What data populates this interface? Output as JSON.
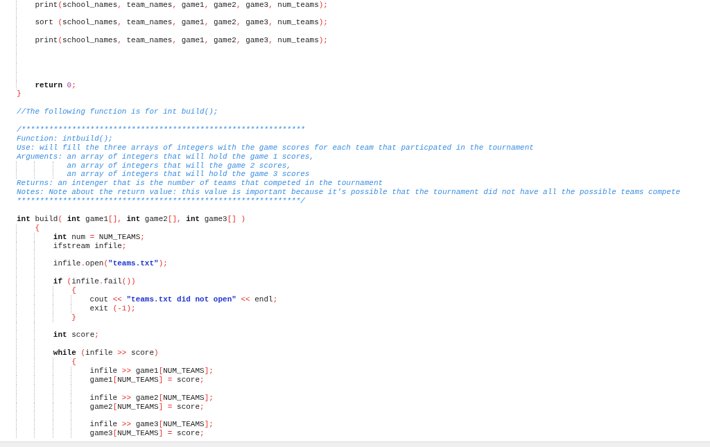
{
  "editor": {
    "lines": [
      {
        "kind": "code",
        "tokens": [
          {
            "kind": "plain",
            "text": "    print"
          },
          {
            "kind": "punct",
            "text": "("
          },
          {
            "kind": "plain",
            "text": "school_names"
          },
          {
            "kind": "punct",
            "text": ","
          },
          {
            "kind": "plain",
            "text": " team_names"
          },
          {
            "kind": "punct",
            "text": ","
          },
          {
            "kind": "plain",
            "text": " game1"
          },
          {
            "kind": "punct",
            "text": ","
          },
          {
            "kind": "plain",
            "text": " game2"
          },
          {
            "kind": "punct",
            "text": ","
          },
          {
            "kind": "plain",
            "text": " game3"
          },
          {
            "kind": "punct",
            "text": ","
          },
          {
            "kind": "plain",
            "text": " num_teams"
          },
          {
            "kind": "punct",
            "text": ");"
          }
        ]
      },
      {
        "kind": "blank"
      },
      {
        "kind": "code",
        "tokens": [
          {
            "kind": "plain",
            "text": "    sort "
          },
          {
            "kind": "punct",
            "text": "("
          },
          {
            "kind": "plain",
            "text": "school_names"
          },
          {
            "kind": "punct",
            "text": ","
          },
          {
            "kind": "plain",
            "text": " team_names"
          },
          {
            "kind": "punct",
            "text": ","
          },
          {
            "kind": "plain",
            "text": " game1"
          },
          {
            "kind": "punct",
            "text": ","
          },
          {
            "kind": "plain",
            "text": " game2"
          },
          {
            "kind": "punct",
            "text": ","
          },
          {
            "kind": "plain",
            "text": " game3"
          },
          {
            "kind": "punct",
            "text": ","
          },
          {
            "kind": "plain",
            "text": " num_teams"
          },
          {
            "kind": "punct",
            "text": ");"
          }
        ]
      },
      {
        "kind": "blank"
      },
      {
        "kind": "code",
        "tokens": [
          {
            "kind": "plain",
            "text": "    print"
          },
          {
            "kind": "punct",
            "text": "("
          },
          {
            "kind": "plain",
            "text": "school_names"
          },
          {
            "kind": "punct",
            "text": ","
          },
          {
            "kind": "plain",
            "text": " team_names"
          },
          {
            "kind": "punct",
            "text": ","
          },
          {
            "kind": "plain",
            "text": " game1"
          },
          {
            "kind": "punct",
            "text": ","
          },
          {
            "kind": "plain",
            "text": " game2"
          },
          {
            "kind": "punct",
            "text": ","
          },
          {
            "kind": "plain",
            "text": " game3"
          },
          {
            "kind": "punct",
            "text": ","
          },
          {
            "kind": "plain",
            "text": " num_teams"
          },
          {
            "kind": "punct",
            "text": ");"
          }
        ]
      },
      {
        "kind": "blank"
      },
      {
        "kind": "blank"
      },
      {
        "kind": "blank"
      },
      {
        "kind": "blank"
      },
      {
        "kind": "code",
        "tokens": [
          {
            "kind": "keyword",
            "text": "    return"
          },
          {
            "kind": "number",
            "text": " 0"
          },
          {
            "kind": "punct",
            "text": ";"
          }
        ]
      },
      {
        "kind": "code",
        "tokens": [
          {
            "kind": "punct",
            "text": "}"
          }
        ]
      },
      {
        "kind": "blank"
      },
      {
        "kind": "code",
        "tokens": [
          {
            "kind": "comment",
            "text": "//The following function is for int build();"
          }
        ]
      },
      {
        "kind": "blank"
      },
      {
        "kind": "code",
        "tokens": [
          {
            "kind": "comment",
            "text": "/**************************************************************"
          }
        ]
      },
      {
        "kind": "code",
        "tokens": [
          {
            "kind": "comment",
            "text": "Function: intbuild();"
          }
        ]
      },
      {
        "kind": "code",
        "tokens": [
          {
            "kind": "comment",
            "text": "Use: will fill the three arrays of integers with the game scores for each team that particpated in the tournament"
          }
        ]
      },
      {
        "kind": "code",
        "tokens": [
          {
            "kind": "comment",
            "text": "Arguments: an array of integers that will hold the game 1 scores,"
          }
        ]
      },
      {
        "kind": "code",
        "tokens": [
          {
            "kind": "comment",
            "text": "           an array of integers that will the game 2 scores,"
          }
        ]
      },
      {
        "kind": "code",
        "tokens": [
          {
            "kind": "comment",
            "text": "           an array of integers that will hold the game 3 scores"
          }
        ]
      },
      {
        "kind": "code",
        "tokens": [
          {
            "kind": "comment",
            "text": "Returns: an intenger that is the number of teams that competed in the tournament"
          }
        ]
      },
      {
        "kind": "code",
        "tokens": [
          {
            "kind": "comment",
            "text": "Notes: Note about the return value: this value is important because it's possible that the tournament did not have all the possible teams compete"
          }
        ]
      },
      {
        "kind": "code",
        "tokens": [
          {
            "kind": "comment",
            "text": "**************************************************************/"
          }
        ]
      },
      {
        "kind": "blank"
      },
      {
        "kind": "code",
        "tokens": [
          {
            "kind": "keyword",
            "text": "int"
          },
          {
            "kind": "plain",
            "text": " build"
          },
          {
            "kind": "punct",
            "text": "("
          },
          {
            "kind": "keyword",
            "text": " int"
          },
          {
            "kind": "plain",
            "text": " game1"
          },
          {
            "kind": "punct",
            "text": "[],"
          },
          {
            "kind": "keyword",
            "text": " int"
          },
          {
            "kind": "plain",
            "text": " game2"
          },
          {
            "kind": "punct",
            "text": "[],"
          },
          {
            "kind": "keyword",
            "text": " int"
          },
          {
            "kind": "plain",
            "text": " game3"
          },
          {
            "kind": "punct",
            "text": "[] )"
          }
        ]
      },
      {
        "kind": "code",
        "tokens": [
          {
            "kind": "punct",
            "text": "    {"
          }
        ]
      },
      {
        "kind": "code",
        "tokens": [
          {
            "kind": "keyword",
            "text": "        int"
          },
          {
            "kind": "plain",
            "text": " num "
          },
          {
            "kind": "punct",
            "text": "="
          },
          {
            "kind": "plain",
            "text": " NUM_TEAMS"
          },
          {
            "kind": "punct",
            "text": ";"
          }
        ]
      },
      {
        "kind": "code",
        "tokens": [
          {
            "kind": "plain",
            "text": "        ifstream infile"
          },
          {
            "kind": "punct",
            "text": ";"
          }
        ]
      },
      {
        "kind": "blank"
      },
      {
        "kind": "code",
        "tokens": [
          {
            "kind": "plain",
            "text": "        infile"
          },
          {
            "kind": "punct",
            "text": "."
          },
          {
            "kind": "plain",
            "text": "open"
          },
          {
            "kind": "punct",
            "text": "("
          },
          {
            "kind": "string",
            "text": "\"teams.txt\""
          },
          {
            "kind": "punct",
            "text": ");"
          }
        ]
      },
      {
        "kind": "blank"
      },
      {
        "kind": "code",
        "tokens": [
          {
            "kind": "keyword",
            "text": "        if"
          },
          {
            "kind": "punct",
            "text": " ("
          },
          {
            "kind": "plain",
            "text": "infile"
          },
          {
            "kind": "punct",
            "text": "."
          },
          {
            "kind": "plain",
            "text": "fail"
          },
          {
            "kind": "punct",
            "text": "())"
          }
        ]
      },
      {
        "kind": "code",
        "tokens": [
          {
            "kind": "punct",
            "text": "            {"
          }
        ]
      },
      {
        "kind": "code",
        "tokens": [
          {
            "kind": "plain",
            "text": "                cout "
          },
          {
            "kind": "punct",
            "text": "<<"
          },
          {
            "kind": "string",
            "text": " \"teams.txt did not open\""
          },
          {
            "kind": "punct",
            "text": " <<"
          },
          {
            "kind": "plain",
            "text": " endl"
          },
          {
            "kind": "punct",
            "text": ";"
          }
        ]
      },
      {
        "kind": "code",
        "tokens": [
          {
            "kind": "plain",
            "text": "                exit "
          },
          {
            "kind": "punct",
            "text": "(-1);"
          }
        ]
      },
      {
        "kind": "code",
        "tokens": [
          {
            "kind": "punct",
            "text": "            }"
          }
        ]
      },
      {
        "kind": "blank"
      },
      {
        "kind": "code",
        "tokens": [
          {
            "kind": "keyword",
            "text": "        int"
          },
          {
            "kind": "plain",
            "text": " score"
          },
          {
            "kind": "punct",
            "text": ";"
          }
        ]
      },
      {
        "kind": "blank"
      },
      {
        "kind": "code",
        "tokens": [
          {
            "kind": "keyword",
            "text": "        while"
          },
          {
            "kind": "punct",
            "text": " ("
          },
          {
            "kind": "plain",
            "text": "infile "
          },
          {
            "kind": "punct",
            "text": ">>"
          },
          {
            "kind": "plain",
            "text": " score"
          },
          {
            "kind": "punct",
            "text": ")"
          }
        ]
      },
      {
        "kind": "code",
        "tokens": [
          {
            "kind": "punct",
            "text": "            {"
          }
        ]
      },
      {
        "kind": "code",
        "tokens": [
          {
            "kind": "plain",
            "text": "                infile "
          },
          {
            "kind": "punct",
            "text": ">>"
          },
          {
            "kind": "plain",
            "text": " game1"
          },
          {
            "kind": "punct",
            "text": "["
          },
          {
            "kind": "plain",
            "text": "NUM_TEAMS"
          },
          {
            "kind": "punct",
            "text": "];"
          }
        ]
      },
      {
        "kind": "code",
        "tokens": [
          {
            "kind": "plain",
            "text": "                game1"
          },
          {
            "kind": "punct",
            "text": "["
          },
          {
            "kind": "plain",
            "text": "NUM_TEAMS"
          },
          {
            "kind": "punct",
            "text": "] ="
          },
          {
            "kind": "plain",
            "text": " score"
          },
          {
            "kind": "punct",
            "text": ";"
          }
        ]
      },
      {
        "kind": "blank"
      },
      {
        "kind": "code",
        "tokens": [
          {
            "kind": "plain",
            "text": "                infile "
          },
          {
            "kind": "punct",
            "text": ">>"
          },
          {
            "kind": "plain",
            "text": " game2"
          },
          {
            "kind": "punct",
            "text": "["
          },
          {
            "kind": "plain",
            "text": "NUM_TEAMS"
          },
          {
            "kind": "punct",
            "text": "];"
          }
        ]
      },
      {
        "kind": "code",
        "tokens": [
          {
            "kind": "plain",
            "text": "                game2"
          },
          {
            "kind": "punct",
            "text": "["
          },
          {
            "kind": "plain",
            "text": "NUM_TEAMS"
          },
          {
            "kind": "punct",
            "text": "] ="
          },
          {
            "kind": "plain",
            "text": " score"
          },
          {
            "kind": "punct",
            "text": ";"
          }
        ]
      },
      {
        "kind": "blank"
      },
      {
        "kind": "code",
        "tokens": [
          {
            "kind": "plain",
            "text": "                infile "
          },
          {
            "kind": "punct",
            "text": ">>"
          },
          {
            "kind": "plain",
            "text": " game3"
          },
          {
            "kind": "punct",
            "text": "["
          },
          {
            "kind": "plain",
            "text": "NUM_TEAMS"
          },
          {
            "kind": "punct",
            "text": "];"
          }
        ]
      },
      {
        "kind": "code",
        "tokens": [
          {
            "kind": "plain",
            "text": "                game3"
          },
          {
            "kind": "punct",
            "text": "["
          },
          {
            "kind": "plain",
            "text": "NUM_TEAMS"
          },
          {
            "kind": "punct",
            "text": "] ="
          },
          {
            "kind": "plain",
            "text": " score"
          },
          {
            "kind": "punct",
            "text": ";"
          }
        ]
      }
    ]
  }
}
